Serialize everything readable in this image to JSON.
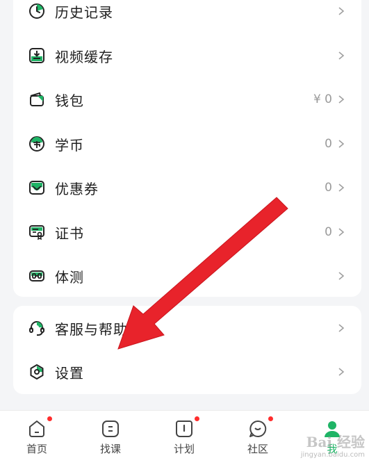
{
  "menu_group1": [
    {
      "icon": "history-icon",
      "label": "历史记录",
      "value": ""
    },
    {
      "icon": "video-download-icon",
      "label": "视频缓存",
      "value": ""
    },
    {
      "icon": "wallet-icon",
      "label": "钱包",
      "value": "¥ 0"
    },
    {
      "icon": "coin-icon",
      "label": "学币",
      "value": "0"
    },
    {
      "icon": "coupon-icon",
      "label": "优惠券",
      "value": "0"
    },
    {
      "icon": "certificate-icon",
      "label": "证书",
      "value": "0"
    },
    {
      "icon": "fitness-test-icon",
      "label": "体测",
      "value": ""
    }
  ],
  "menu_group2": [
    {
      "icon": "headset-icon",
      "label": "客服与帮助",
      "value": ""
    },
    {
      "icon": "settings-icon",
      "label": "设置",
      "value": ""
    }
  ],
  "tabs": [
    {
      "icon": "home-icon",
      "label": "首页",
      "badge": true
    },
    {
      "icon": "find-course-icon",
      "label": "找课",
      "badge": false
    },
    {
      "icon": "plan-icon",
      "label": "计划",
      "badge": true
    },
    {
      "icon": "community-icon",
      "label": "社区",
      "badge": true
    },
    {
      "icon": "profile-icon",
      "label": "我",
      "badge": false,
      "active": true
    }
  ],
  "watermark": {
    "main": "Bai 经验",
    "sub": "jingyan.baidu.com"
  },
  "colors": {
    "accent": "#1fb466",
    "badge": "#ff2d2d",
    "annotation_arrow": "#e8232b"
  }
}
